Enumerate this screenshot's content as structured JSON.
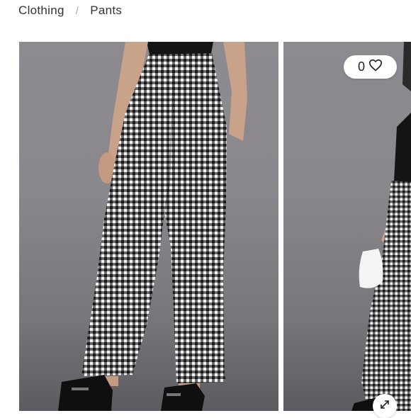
{
  "breadcrumb": {
    "items": [
      "Clothing",
      "Pants"
    ],
    "separator": "/"
  },
  "gallery": {
    "images": [
      {
        "subject": "back view of black and white gingham flared pants with black loafers"
      },
      {
        "subject": "side view of model in gingham pants holding white bag"
      }
    ]
  },
  "favorite": {
    "count": "0",
    "icon": "heart-icon"
  },
  "expand": {
    "icon": "expand-arrows-icon"
  }
}
